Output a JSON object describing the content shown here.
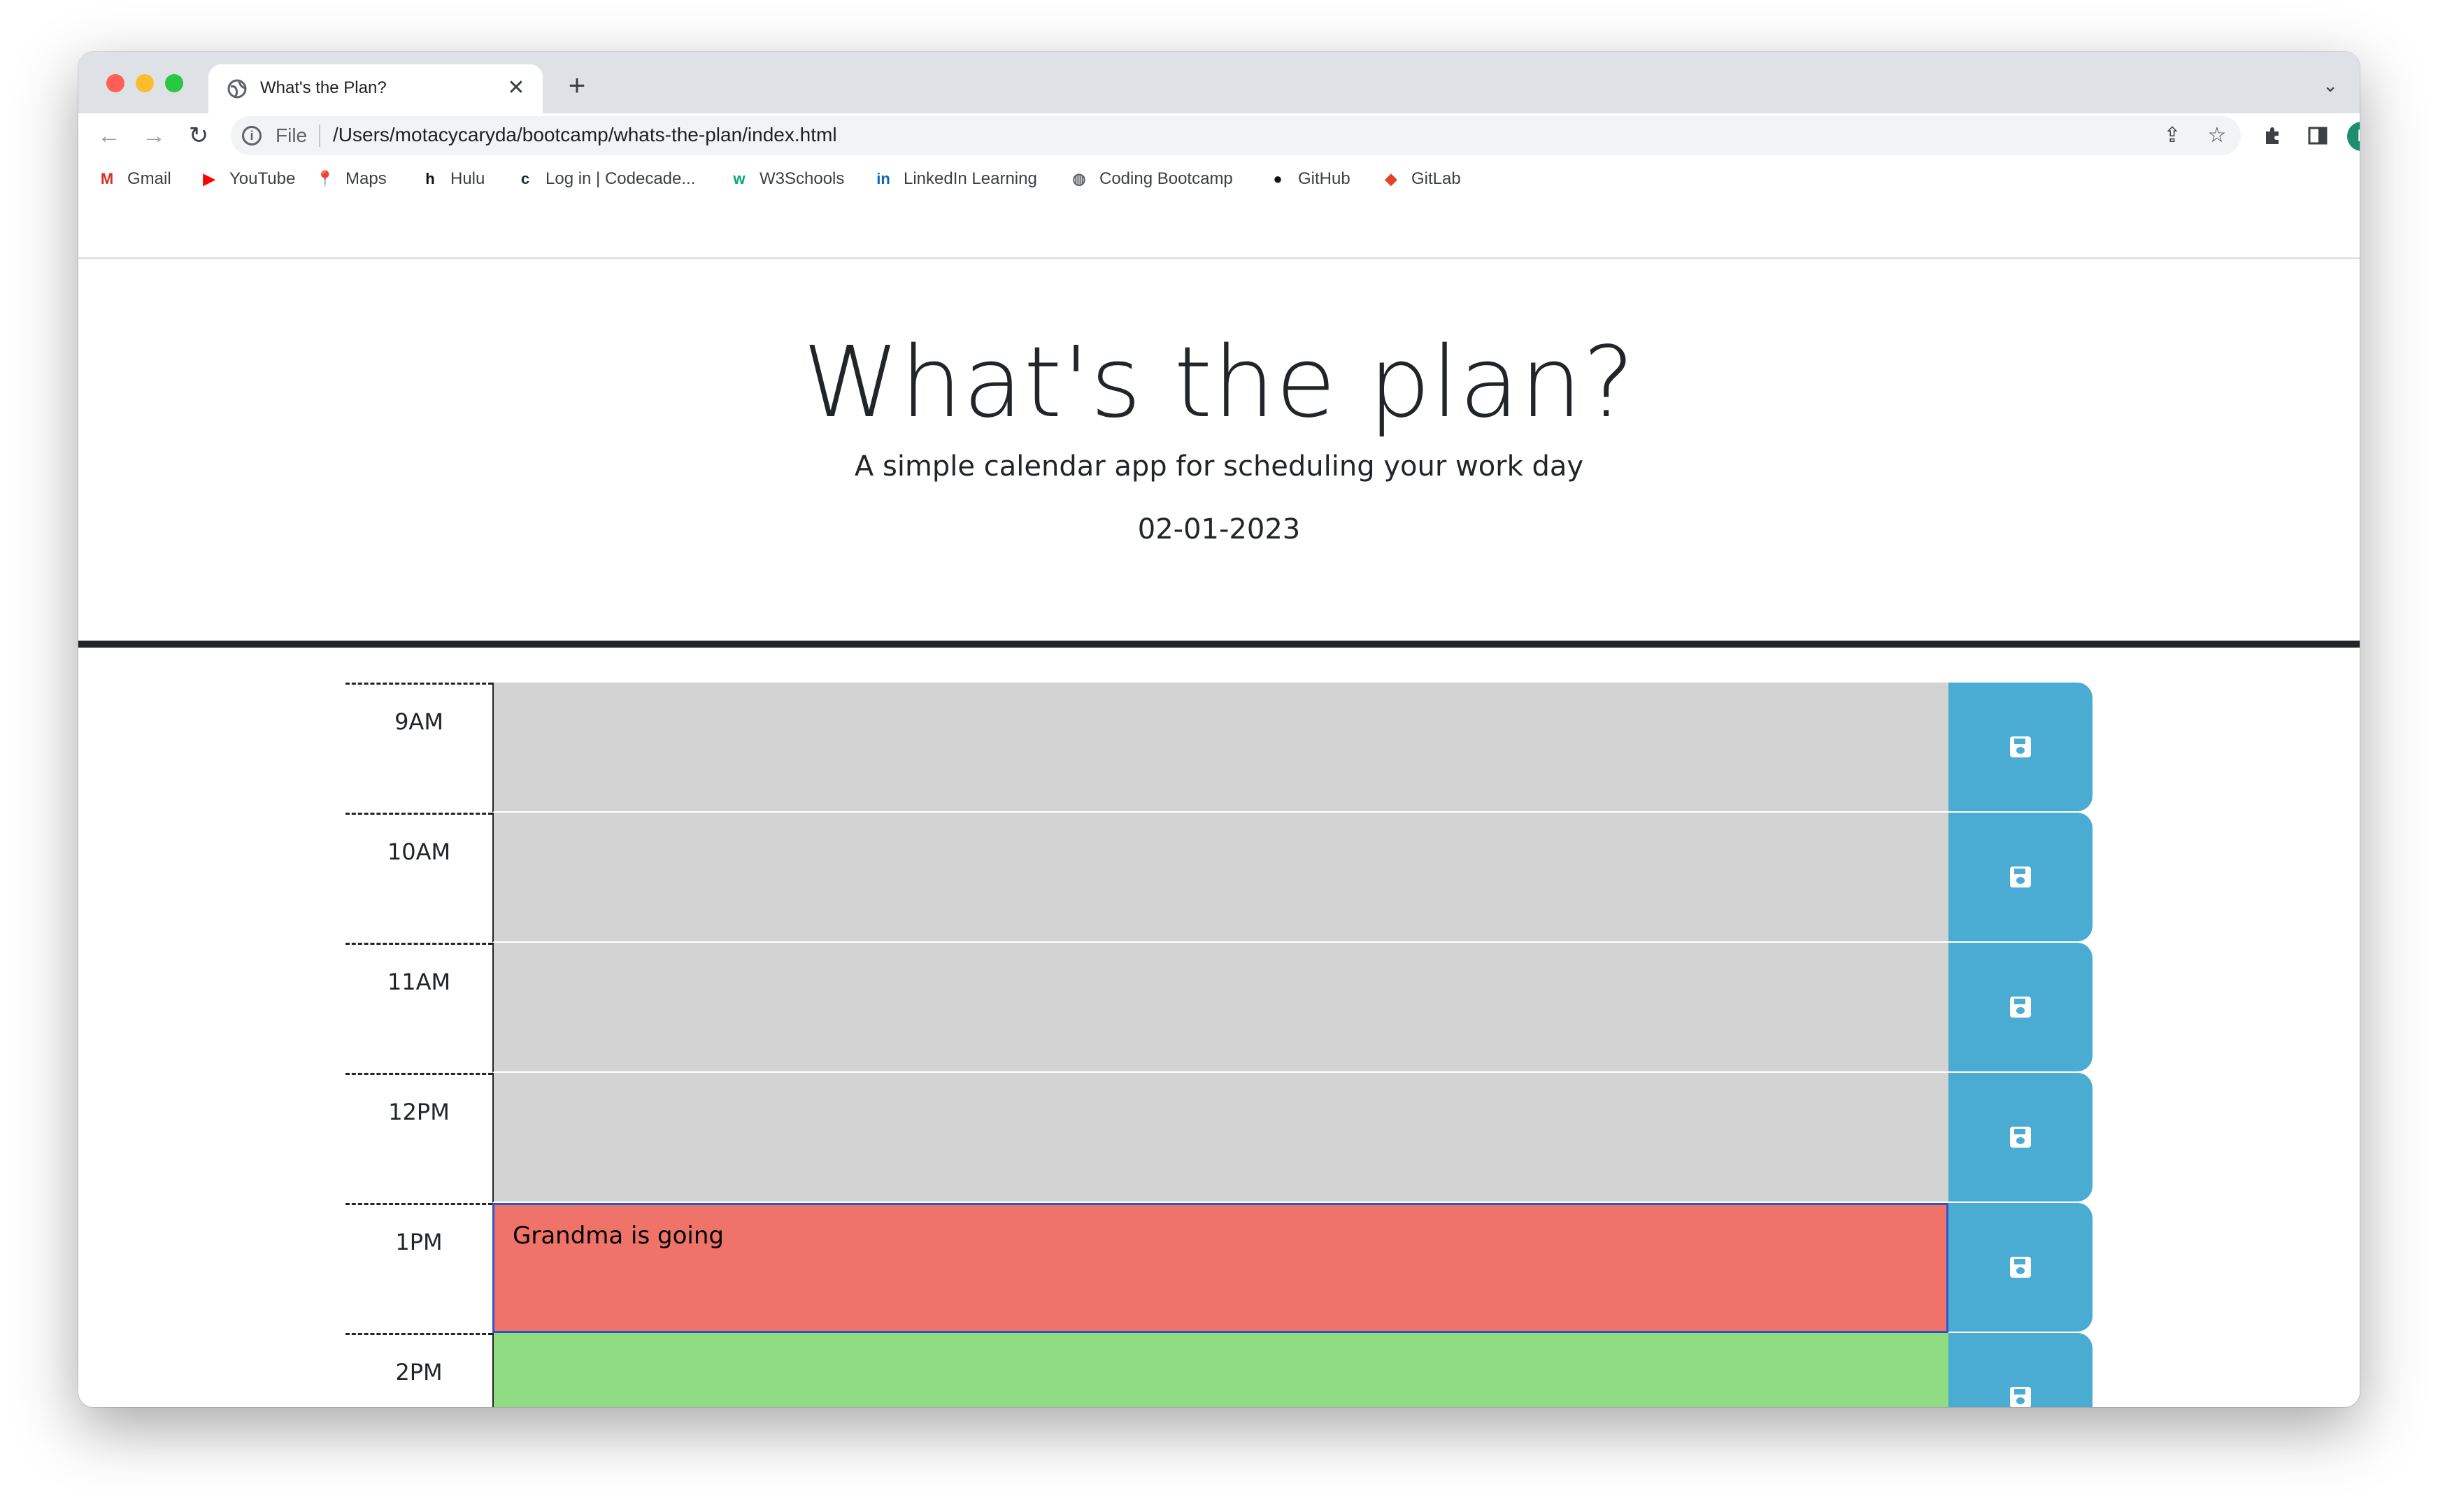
{
  "browser": {
    "tab_title": "What's the Plan?",
    "tab_close": "✕",
    "new_tab": "+",
    "tab_search": "⌄",
    "url_scheme": "File",
    "url": "/Users/motacycaryda/bootcamp/whats-the-plan/index.html",
    "avatar_initial": "L",
    "bookmarks": [
      {
        "label": "Gmail",
        "icon": "gmail-icon",
        "glyph": "M",
        "color": "#d93025"
      },
      {
        "label": "YouTube",
        "icon": "youtube-icon",
        "glyph": "▶",
        "color": "#ff0000"
      },
      {
        "label": "Maps",
        "icon": "maps-icon",
        "glyph": "📍",
        "color": "#34a853"
      },
      {
        "label": "Hulu",
        "icon": "hulu-icon",
        "glyph": "h",
        "color": "#111111"
      },
      {
        "label": "Log in | Codecade...",
        "icon": "codecademy-icon",
        "glyph": "c",
        "color": "#1f2937"
      },
      {
        "label": "W3Schools",
        "icon": "w3schools-icon",
        "glyph": "w",
        "color": "#04aa6d"
      },
      {
        "label": "LinkedIn Learning",
        "icon": "linkedin-icon",
        "glyph": "in",
        "color": "#0a66c2"
      },
      {
        "label": "Coding Bootcamp",
        "icon": "globe-icon",
        "glyph": "◍",
        "color": "#5f6368"
      },
      {
        "label": "GitHub",
        "icon": "github-icon",
        "glyph": "●",
        "color": "#111111"
      },
      {
        "label": "GitLab",
        "icon": "gitlab-icon",
        "glyph": "◆",
        "color": "#e24329"
      }
    ]
  },
  "page": {
    "title": "What's the plan?",
    "lead": "A simple calendar app for scheduling your work day",
    "date": "02-01-2023"
  },
  "colors": {
    "past": "#d3d3d3",
    "present": "#ef7369",
    "future": "#90dc82",
    "save_button": "#4aabd3"
  },
  "schedule": [
    {
      "hour": "9AM",
      "text": "",
      "state": "past"
    },
    {
      "hour": "10AM",
      "text": "",
      "state": "past"
    },
    {
      "hour": "11AM",
      "text": "",
      "state": "past"
    },
    {
      "hour": "12PM",
      "text": "",
      "state": "past"
    },
    {
      "hour": "1PM",
      "text": "Grandma is going",
      "state": "present"
    },
    {
      "hour": "2PM",
      "text": "",
      "state": "future"
    }
  ]
}
